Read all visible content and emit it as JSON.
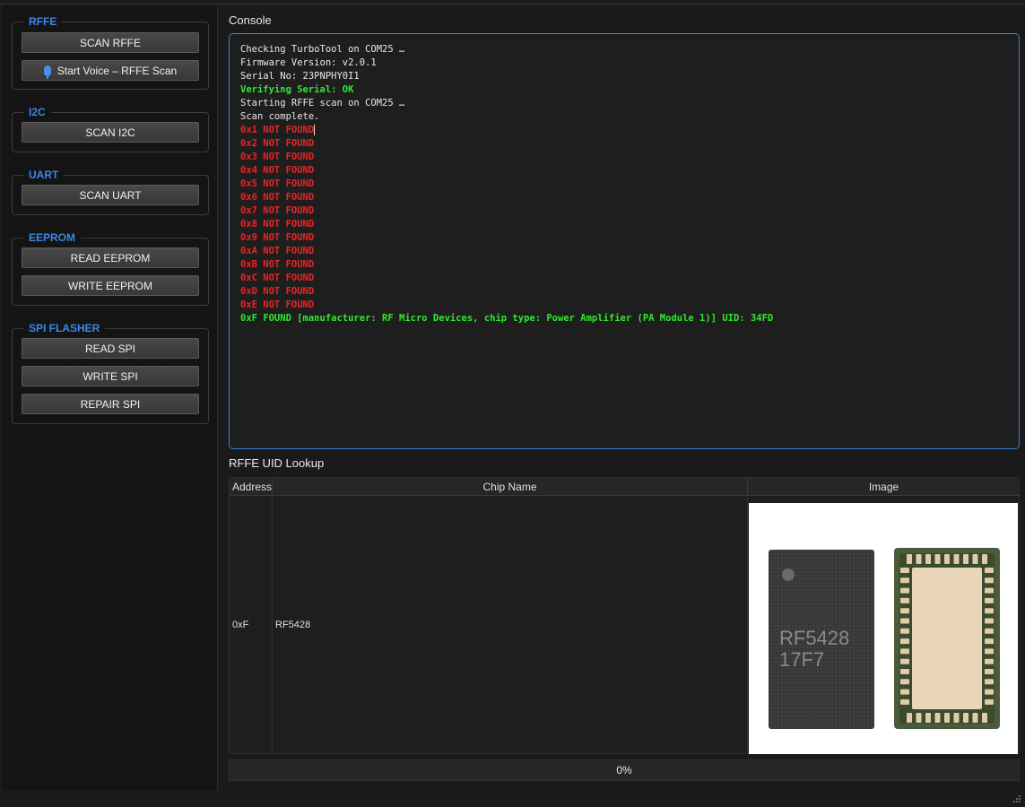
{
  "sidebar": {
    "rffe": {
      "title": "RFFE",
      "scan_label": "SCAN RFFE",
      "voice_label": "Start Voice – RFFE Scan"
    },
    "i2c": {
      "title": "I2C",
      "scan_label": "SCAN I2C"
    },
    "uart": {
      "title": "UART",
      "scan_label": "SCAN UART"
    },
    "eeprom": {
      "title": "EEPROM",
      "read_label": "READ EEPROM",
      "write_label": "WRITE EEPROM"
    },
    "spi": {
      "title": "SPI FLASHER",
      "read_label": "READ SPI",
      "write_label": "WRITE SPI",
      "repair_label": "REPAIR SPI"
    }
  },
  "console": {
    "title": "Console",
    "lines": [
      {
        "text": "Checking TurboTool on COM25 …",
        "color": "white"
      },
      {
        "text": "Firmware Version: v2.0.1",
        "color": "white"
      },
      {
        "text": "Serial No: 23PNPHY0I1",
        "color": "white"
      },
      {
        "text": "Verifying Serial: OK",
        "color": "green"
      },
      {
        "text": "Starting RFFE scan on COM25 …",
        "color": "white"
      },
      {
        "text": "Scan complete.",
        "color": "white"
      },
      {
        "text": "0x1 NOT FOUND",
        "color": "red"
      },
      {
        "text": "0x2 NOT FOUND",
        "color": "red"
      },
      {
        "text": "0x3 NOT FOUND",
        "color": "red"
      },
      {
        "text": "0x4 NOT FOUND",
        "color": "red"
      },
      {
        "text": "0x5 NOT FOUND",
        "color": "red"
      },
      {
        "text": "0x6 NOT FOUND",
        "color": "red"
      },
      {
        "text": "0x7 NOT FOUND",
        "color": "red"
      },
      {
        "text": "0x8 NOT FOUND",
        "color": "red"
      },
      {
        "text": "0x9 NOT FOUND",
        "color": "red"
      },
      {
        "text": "0xA NOT FOUND",
        "color": "red"
      },
      {
        "text": "0xB NOT FOUND",
        "color": "red"
      },
      {
        "text": "0xC NOT FOUND",
        "color": "red"
      },
      {
        "text": "0xD NOT FOUND",
        "color": "red"
      },
      {
        "text": "0xE NOT FOUND",
        "color": "red"
      },
      {
        "text": "0xF FOUND [manufacturer: RF Micro Devices, chip type: Power Amplifier (PA Module 1)] UID: 34FD",
        "color": "green"
      }
    ]
  },
  "lookup": {
    "title": "RFFE UID Lookup",
    "columns": [
      "Address",
      "Chip Name",
      "Image"
    ],
    "row": {
      "address": "0xF",
      "chip_name": "RF5428",
      "chip_marking_line1": "RF5428",
      "chip_marking_line2": "17F7"
    }
  },
  "progress": {
    "label": "0%",
    "value": 0
  },
  "colors": {
    "accent": "#3d86e8",
    "ok": "#2ee82e",
    "error": "#ee2222"
  }
}
